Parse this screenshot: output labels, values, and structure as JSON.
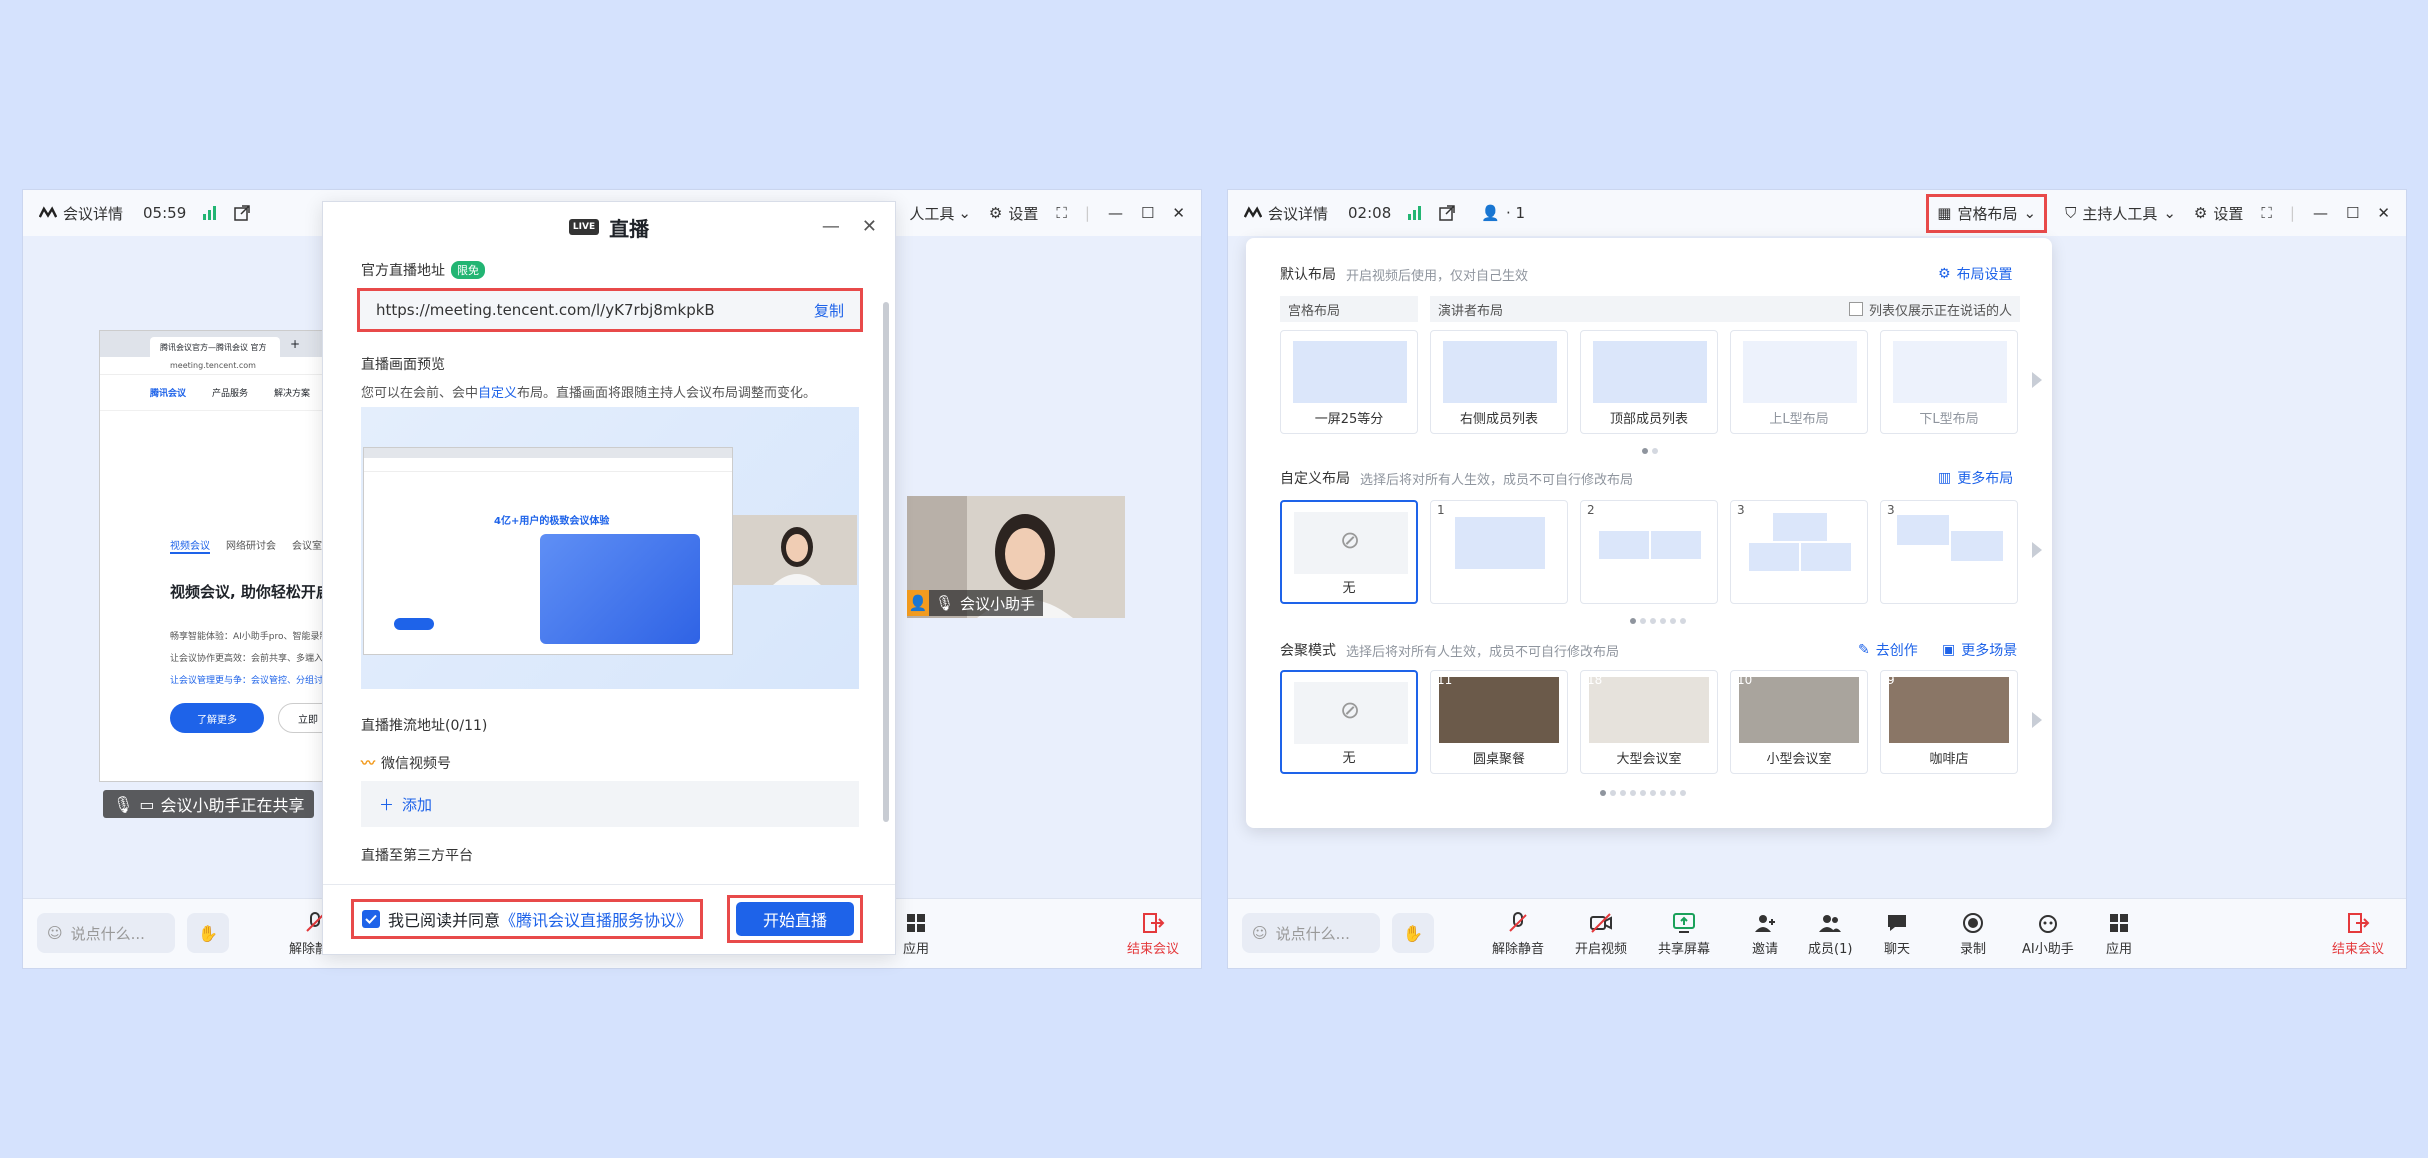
{
  "left": {
    "titlebar": {
      "meeting_details": "会议详情",
      "timer": "05:59",
      "host_tools": "人工具",
      "settings": "设置"
    },
    "shared": {
      "tab_title": "腾讯会议官方—腾讯会议 官方",
      "url": "meeting.tencent.com",
      "brand": "腾讯会议",
      "nav1": "产品服务",
      "nav2": "解决方案",
      "tabs": [
        "视频会议",
        "网络研讨会",
        "会议室Roo"
      ],
      "headline": "视频会议, 助你轻松开启远",
      "line1": "畅享智能体验：AI小助手pro、智能录制",
      "line2": "让会议协作更高效：会前共享、多端入会",
      "line3": "让会议管理更与争：会议管控、分组讨论",
      "btn": "了解更多",
      "btn2": "立即"
    },
    "sharing_label": "会议小助手正在共享",
    "video_name": "会议小助手",
    "bottombar": {
      "say_placeholder": "说点什么...",
      "unmute": "解除静音",
      "apps": "应用",
      "end": "结束会议"
    },
    "live": {
      "title": "直播",
      "official_url_label": "官方直播地址",
      "free_tag": "限免",
      "url": "https://meeting.tencent.com/l/yK7rbj8mkpkB",
      "copy": "复制",
      "preview_label": "直播画面预览",
      "preview_desc_pre": "您可以在会前、会中",
      "preview_desc_link": "自定义",
      "preview_desc_post": "布局。直播画面将跟随主持人会议布局调整而变化。",
      "preview_slogan": "4亿+用户的极致会议体验",
      "push_label": "直播推流地址(0/11)",
      "wechat": "微信视频号",
      "add": "添加",
      "third_party": "直播至第三方平台",
      "agree_pre": "我已阅读并同意",
      "agree_link": "《腾讯会议直播服务协议》",
      "start": "开始直播"
    }
  },
  "right": {
    "titlebar": {
      "meeting_details": "会议详情",
      "timer": "02:08",
      "participants": "· 1",
      "grid_layout": "宫格布局",
      "host_tools": "主持人工具",
      "settings": "设置"
    },
    "panel": {
      "default_title": "默认布局",
      "default_sub": "开启视频后使用，仅对自己生效",
      "layout_settings": "布局设置",
      "grid_label": "宫格布局",
      "speaker_label": "演讲者布局",
      "only_speaking": "列表仅展示正在说话的人",
      "default_cards": [
        "一屏25等分",
        "右侧成员列表",
        "顶部成员列表",
        "上L型布局",
        "下L型布局"
      ],
      "custom_title": "自定义布局",
      "custom_sub": "选择后将对所有人生效，成员不可自行修改布局",
      "more_layouts": "更多布局",
      "custom_cards": [
        {
          "count": "",
          "label": "无"
        },
        {
          "count": "1",
          "label": ""
        },
        {
          "count": "2",
          "label": ""
        },
        {
          "count": "3",
          "label": ""
        },
        {
          "count": "3",
          "label": ""
        }
      ],
      "focus_title": "会聚模式",
      "focus_sub": "选择后将对所有人生效，成员不可自行修改布局",
      "create": "去创作",
      "more_scenes": "更多场景",
      "focus_cards": [
        {
          "count": "",
          "label": "无"
        },
        {
          "count": "11",
          "label": "圆桌聚餐"
        },
        {
          "count": "18",
          "label": "大型会议室"
        },
        {
          "count": "10",
          "label": "小型会议室"
        },
        {
          "count": "9",
          "label": "咖啡店"
        }
      ]
    },
    "bottombar": {
      "say_placeholder": "说点什么...",
      "unmute": "解除静音",
      "video": "开启视频",
      "share": "共享屏幕",
      "invite": "邀请",
      "members": "成员(1)",
      "chat": "聊天",
      "record": "录制",
      "ai": "AI小助手",
      "apps": "应用",
      "end": "结束会议"
    }
  }
}
